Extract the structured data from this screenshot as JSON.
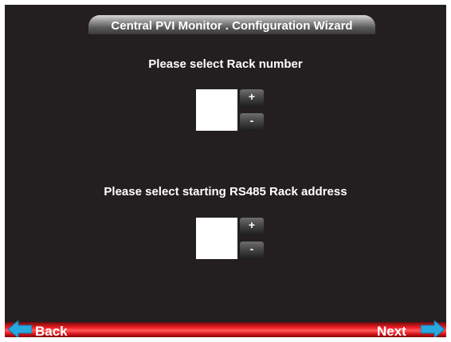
{
  "header": {
    "title": "Central PVI Monitor . Configuration Wizard"
  },
  "rack_number": {
    "label": "Please select Rack number",
    "value": "",
    "increment_label": "+",
    "decrement_label": "-"
  },
  "rack_address": {
    "label": "Please select starting RS485 Rack address",
    "value": "",
    "increment_label": "+",
    "decrement_label": "-"
  },
  "nav": {
    "back_label": "Back",
    "next_label": "Next",
    "bar_color": "#ee1c24",
    "arrow_color": "#29a8e0"
  },
  "colors": {
    "background": "#231f20",
    "text": "#ffffff"
  }
}
